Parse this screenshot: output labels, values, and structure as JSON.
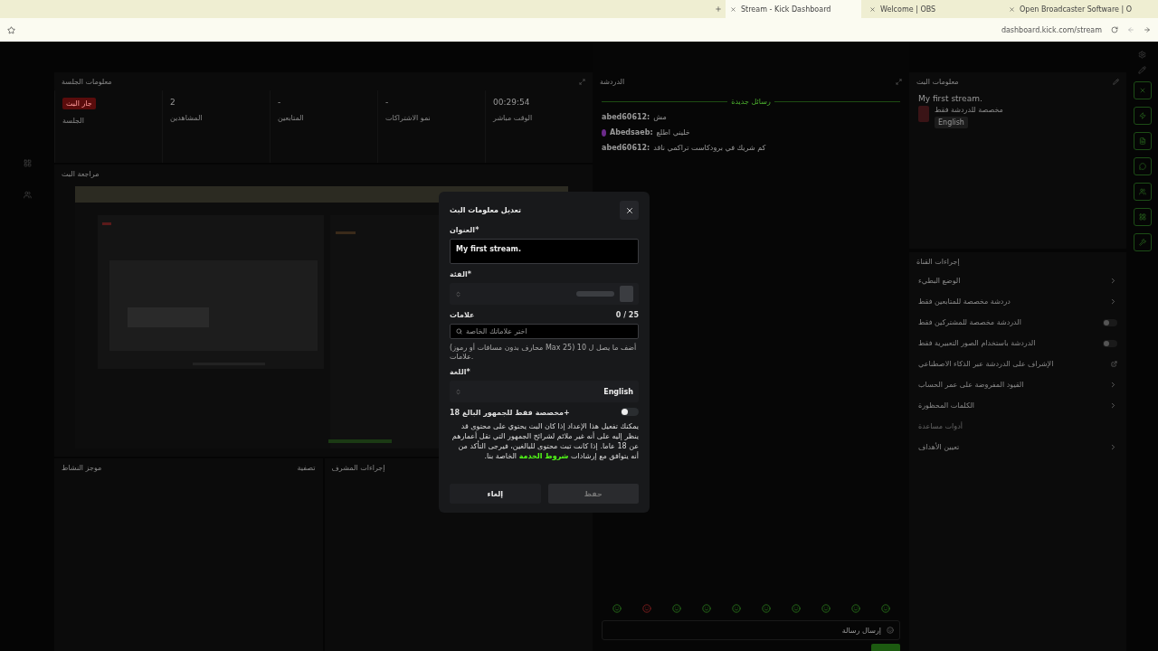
{
  "browser": {
    "tabs": [
      {
        "title": "Open Broadcaster Software | O",
        "selected": false
      },
      {
        "title": "Welcome | OBS",
        "selected": false
      },
      {
        "title": "Stream - Kick Dashboard",
        "selected": true
      }
    ],
    "url": "dashboard.kick.com/stream"
  },
  "session": {
    "title": "معلومات الجلسة",
    "stats": [
      {
        "kind": "plain",
        "value": "00:29:54",
        "label": "الوقت مباشر"
      },
      {
        "kind": "plain",
        "value": "-",
        "label": "نمو الاشتراكات"
      },
      {
        "kind": "plain",
        "value": "-",
        "label": "المتابعين"
      },
      {
        "kind": "plain",
        "value": "2",
        "label": "المشاهدين"
      },
      {
        "kind": "badge",
        "value": "جار البث",
        "label": "الجلسة"
      }
    ]
  },
  "preview": {
    "title": "مراجعة البث",
    "kind": "picture"
  },
  "bottom_panels": [
    {
      "title": "إجراءات المشرف"
    },
    {
      "title": "موجز النشاط",
      "action": "تصفية"
    }
  ],
  "chat": {
    "title": "الدردشة",
    "divider": "رسائل جديدة",
    "messages": [
      {
        "user": "abed60612:",
        "text": "مش",
        "badge": false
      },
      {
        "user": "Abedsaeb:",
        "text": "خليني اطلع",
        "badge": true
      },
      {
        "user": "abed60612:",
        "text": "كم شريك في برودكاست تراكمي ناقد",
        "badge": false
      }
    ],
    "input_placeholder": "إرسال رسالة"
  },
  "stream_info": {
    "title": "معلومات البث",
    "stream_title": "My first stream.",
    "category": "مخصصة للدردشة فقط",
    "language": "English"
  },
  "channel_actions": {
    "title": "إجراءات القناة",
    "items": [
      {
        "kind": "chevron",
        "label": "الوضع البطيء"
      },
      {
        "kind": "chevron",
        "label": "دردشة مخصصة للمتابعين فقط"
      },
      {
        "kind": "toggle",
        "label": "الدردشة مخصصة للمشتركين فقط",
        "on": false
      },
      {
        "kind": "toggle",
        "label": "الدردشة باستخدام الصور التعبيرية فقط",
        "on": false
      },
      {
        "kind": "link",
        "label": "الإشراف على الدردشة عبر الذكاء الاصطناعي"
      },
      {
        "kind": "chevron",
        "label": "القيود المفروضة على عمر الحساب"
      },
      {
        "kind": "chevron",
        "label": "الكلمات المحظورة"
      },
      {
        "kind": "section",
        "label": "أدوات مساعدة"
      },
      {
        "kind": "chevron",
        "label": "تعيين الأهداف"
      }
    ]
  },
  "modal": {
    "title": "تعديل معلومات البث",
    "title_label": "العنوان*",
    "title_value": "My first stream.",
    "category_label": "الفئة*",
    "tags_label": "علامات",
    "tags_count": "0 / 25",
    "tags_placeholder": "اختر علاماتك الخاصة",
    "tags_hint": "(محارف بدون مسافات أو رموز Max 25) أضف ما يصل ل 10 علامات.",
    "language_label": "اللغة*",
    "language_value": "English",
    "adult_label": "مخصصة فقط للجمهور البالغ 18+",
    "adult_on": false,
    "adult_note": "يمكنك تفعيل هذا الإعداد إذا كان البث يحتوي على محتوى قد ينظر إليه على أنه غير ملائم لشرائح الجمهور التي تقل أعمارهم عن 18 عاما. إذا كانت تبث محتوى للبالغين، فيرجى التأكد من أنه يتوافق مع إرشادات ",
    "adult_link": "شروط الخدمة",
    "adult_note_end": " الخاصة بنا.",
    "buttons": [
      {
        "label": "حفظ",
        "disabled": true
      },
      {
        "label": "إلغاء",
        "disabled": false
      }
    ]
  }
}
